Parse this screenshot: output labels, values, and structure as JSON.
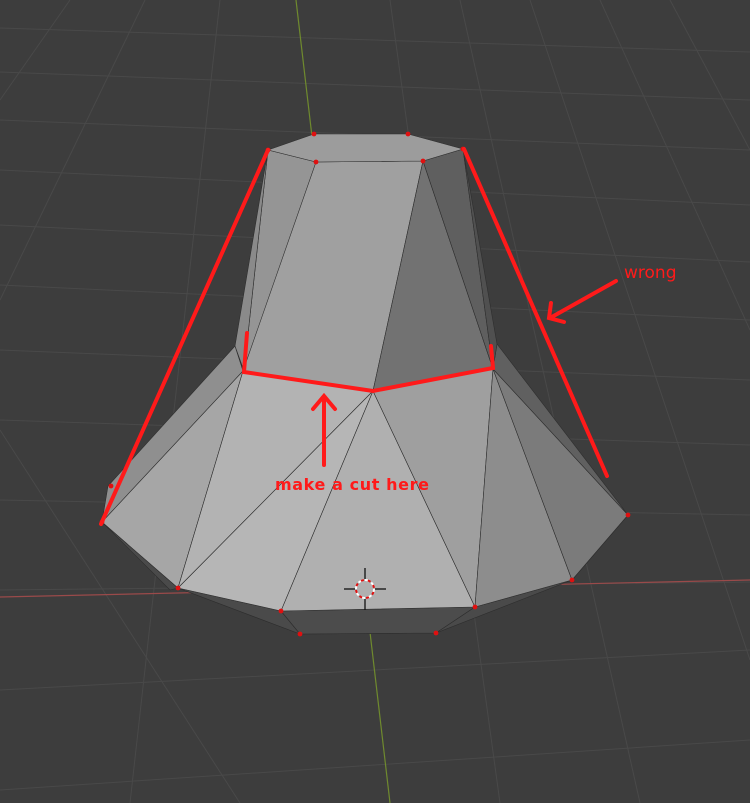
{
  "viewport": {
    "background": "#3d3d3d",
    "grid_color": "#494949",
    "x_axis_color": "#9a4a4a",
    "y_axis_color": "#6f8a2e"
  },
  "object": {
    "base_color": "#a3a3a3",
    "vertex_color": "#e01010"
  },
  "annotations": {
    "color": "#ff1a1a",
    "wrong_label": "wrong",
    "cut_label": "make a cut here"
  },
  "cursor": {
    "icon": "3d-cursor-icon"
  }
}
